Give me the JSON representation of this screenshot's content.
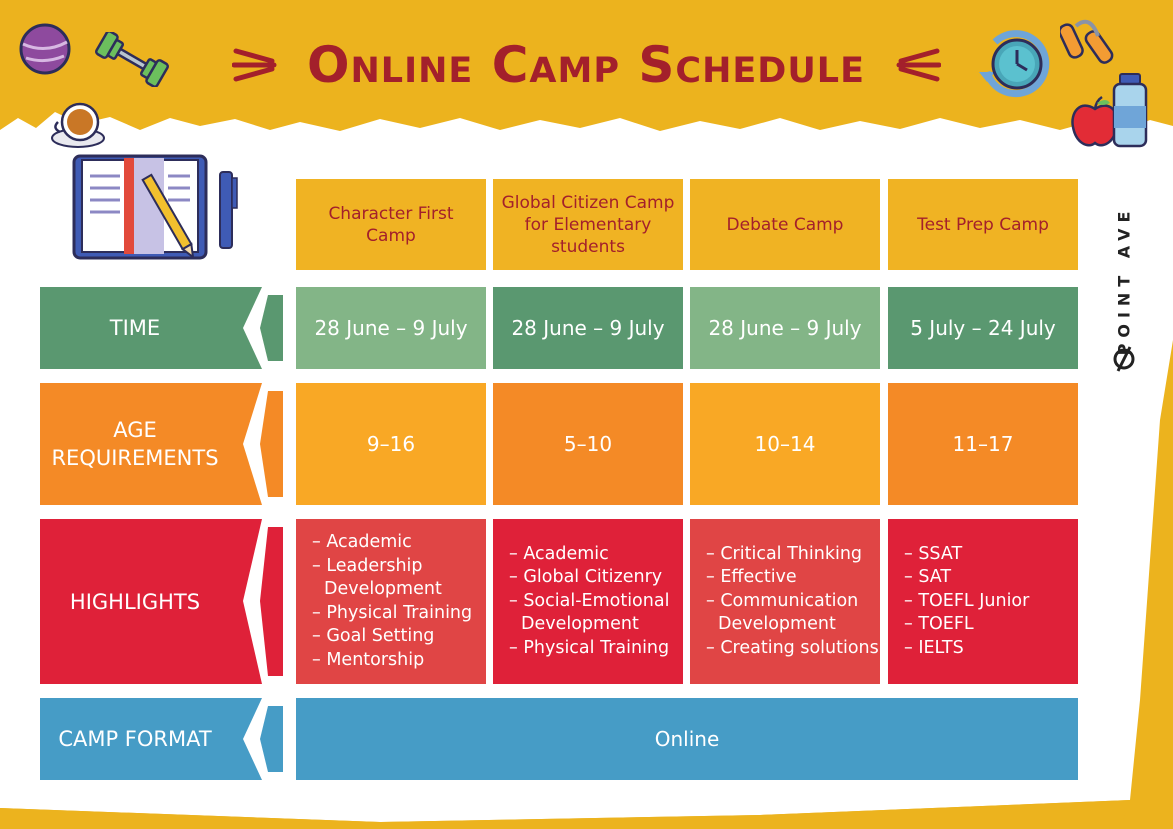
{
  "title": "Online Camp Schedule",
  "brand": "POINT AVE",
  "camps": [
    {
      "name": "Character First Camp",
      "time": "28 June – 9 July",
      "age": "9–16",
      "highlights": [
        "Academic",
        "Leadership",
        "Development",
        "Physical Training",
        "Goal Setting",
        "Mentorship"
      ]
    },
    {
      "name": "Global Citizen Camp for Elementary students",
      "time": "28 June – 9 July",
      "age": "5–10",
      "highlights": [
        "Academic",
        "Global Citizenry",
        "Social-Emotional",
        "Development",
        "Physical Training"
      ]
    },
    {
      "name": "Debate Camp",
      "time": "28 June – 9 July",
      "age": "10–14",
      "highlights": [
        "Critical Thinking",
        "Effective",
        "Communication",
        "Development",
        "Creating solutions"
      ]
    },
    {
      "name": "Test Prep Camp",
      "time": "5 July – 24 July",
      "age": "11–17",
      "highlights": [
        "SSAT",
        "SAT",
        "TOEFL Junior",
        "TOEFL",
        "IELTS"
      ]
    }
  ],
  "rows": {
    "time": "TIME",
    "age": "AGE REQUIREMENTS",
    "highlights": "HIGHLIGHTS",
    "format": "CAMP FORMAT"
  },
  "format_value": "Online",
  "colors": {
    "background": "#ECB31E",
    "title": "#A3202B",
    "time_label": "#5A9870",
    "time_light": "#83B587",
    "age_label": "#F48A26",
    "age_light": "#F9A825",
    "highlight_label": "#DF2139",
    "highlight_light": "#E04545",
    "format": "#469CC6"
  },
  "icons": [
    "fitness-ball-icon",
    "dumbbell-icon",
    "coffee-cup-icon",
    "notebook-icon",
    "pen-icon",
    "stopwatch-icon",
    "hand-gripper-icon",
    "apple-icon",
    "water-bottle-icon",
    "point-ave-logo-icon"
  ]
}
